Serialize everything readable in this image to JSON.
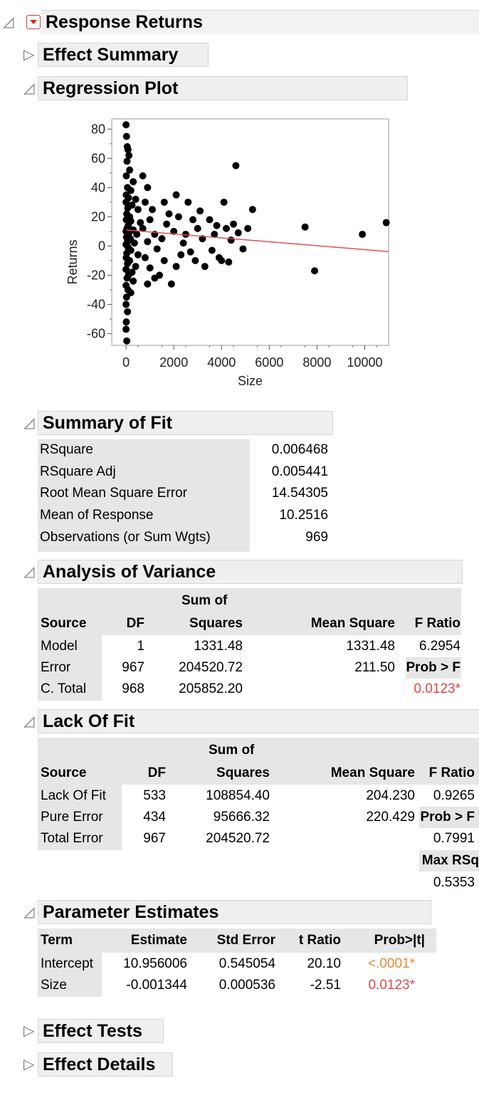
{
  "report": {
    "title": "Response Returns",
    "effect_summary": "Effect Summary",
    "regression_plot": "Regression Plot",
    "summary_of_fit": "Summary of Fit",
    "analysis_of_variance": "Analysis of Variance",
    "lack_of_fit": "Lack Of Fit",
    "parameter_estimates": "Parameter Estimates",
    "effect_tests": "Effect Tests",
    "effect_details": "Effect Details"
  },
  "chart_data": {
    "type": "scatter",
    "xlabel": "Size",
    "ylabel": "Returns",
    "xlim": [
      -600,
      11000
    ],
    "ylim": [
      -68,
      87
    ],
    "xticks": [
      "0",
      "2000",
      "4000",
      "6000",
      "8000",
      "10000"
    ],
    "yticks": [
      "80",
      "60",
      "40",
      "20",
      "0",
      "-20",
      "-40",
      "-60"
    ],
    "fit_line": {
      "intercept": 10.956006,
      "slope": -0.001344,
      "color": "#e05050"
    },
    "point_color": "#000000",
    "points": [
      [
        0,
        83
      ],
      [
        20,
        75
      ],
      [
        50,
        68
      ],
      [
        80,
        66
      ],
      [
        120,
        62
      ],
      [
        40,
        58
      ],
      [
        150,
        52
      ],
      [
        10,
        48
      ],
      [
        300,
        44
      ],
      [
        60,
        40
      ],
      [
        200,
        38
      ],
      [
        10,
        35
      ],
      [
        100,
        33
      ],
      [
        400,
        32
      ],
      [
        0,
        30
      ],
      [
        250,
        28
      ],
      [
        70,
        26
      ],
      [
        500,
        25
      ],
      [
        30,
        22
      ],
      [
        150,
        20
      ],
      [
        10,
        18
      ],
      [
        200,
        17
      ],
      [
        600,
        16
      ],
      [
        90,
        14
      ],
      [
        40,
        12
      ],
      [
        300,
        11
      ],
      [
        0,
        10
      ],
      [
        120,
        9
      ],
      [
        450,
        8
      ],
      [
        20,
        6
      ],
      [
        180,
        5
      ],
      [
        60,
        3
      ],
      [
        350,
        2
      ],
      [
        0,
        1
      ],
      [
        90,
        -1
      ],
      [
        200,
        -3
      ],
      [
        30,
        -5
      ],
      [
        500,
        -6
      ],
      [
        10,
        -8
      ],
      [
        150,
        -10
      ],
      [
        60,
        -12
      ],
      [
        400,
        -14
      ],
      [
        0,
        -16
      ],
      [
        250,
        -18
      ],
      [
        100,
        -20
      ],
      [
        40,
        -22
      ],
      [
        300,
        -24
      ],
      [
        0,
        -27
      ],
      [
        80,
        -30
      ],
      [
        200,
        -32
      ],
      [
        20,
        -35
      ],
      [
        0,
        -40
      ],
      [
        60,
        -45
      ],
      [
        10,
        -52
      ],
      [
        0,
        -57
      ],
      [
        30,
        -65
      ],
      [
        700,
        48
      ],
      [
        900,
        40
      ],
      [
        800,
        30
      ],
      [
        1100,
        25
      ],
      [
        1000,
        18
      ],
      [
        700,
        12
      ],
      [
        1200,
        8
      ],
      [
        900,
        3
      ],
      [
        1300,
        -2
      ],
      [
        800,
        -8
      ],
      [
        1000,
        -15
      ],
      [
        1200,
        -22
      ],
      [
        900,
        -26
      ],
      [
        1400,
        -20
      ],
      [
        1600,
        -10
      ],
      [
        1500,
        5
      ],
      [
        1700,
        15
      ],
      [
        1800,
        22
      ],
      [
        1600,
        30
      ],
      [
        1900,
        -26
      ],
      [
        2100,
        35
      ],
      [
        2200,
        20
      ],
      [
        2000,
        10
      ],
      [
        2400,
        2
      ],
      [
        2300,
        -6
      ],
      [
        2100,
        -14
      ],
      [
        2600,
        30
      ],
      [
        2800,
        18
      ],
      [
        2500,
        8
      ],
      [
        2700,
        -4
      ],
      [
        2900,
        -10
      ],
      [
        3100,
        24
      ],
      [
        3000,
        12
      ],
      [
        3300,
        -14
      ],
      [
        3200,
        5
      ],
      [
        3500,
        18
      ],
      [
        3700,
        8
      ],
      [
        3600,
        -3
      ],
      [
        3900,
        -8
      ],
      [
        3800,
        14
      ],
      [
        4100,
        30
      ],
      [
        4000,
        -10
      ],
      [
        4200,
        12
      ],
      [
        4400,
        4
      ],
      [
        4500,
        15
      ],
      [
        4700,
        9
      ],
      [
        4600,
        55
      ],
      [
        4900,
        -2
      ],
      [
        5100,
        12
      ],
      [
        5300,
        25
      ],
      [
        7500,
        13
      ],
      [
        7900,
        -17
      ],
      [
        9900,
        8
      ],
      [
        10900,
        16
      ],
      [
        4300,
        -11
      ]
    ]
  },
  "summary_of_fit": {
    "rows": [
      {
        "label": "RSquare",
        "value": "0.006468"
      },
      {
        "label": "RSquare Adj",
        "value": "0.005441"
      },
      {
        "label": "Root Mean Square Error",
        "value": "14.54305"
      },
      {
        "label": "Mean of Response",
        "value": "10.2516"
      },
      {
        "label": "Observations (or Sum Wgts)",
        "value": "969"
      }
    ]
  },
  "anova": {
    "headers": {
      "source": "Source",
      "df": "DF",
      "ss_top": "Sum of",
      "ss": "Squares",
      "ms": "Mean Square",
      "f": "F Ratio"
    },
    "rows": [
      {
        "source": "Model",
        "df": "1",
        "ss": "1331.48",
        "ms": "1331.48",
        "extra": "6.2954"
      },
      {
        "source": "Error",
        "df": "967",
        "ss": "204520.72",
        "ms": "211.50",
        "extra": "Prob > F"
      },
      {
        "source": "C. Total",
        "df": "968",
        "ss": "205852.20",
        "ms": "",
        "extra": "0.0123*"
      }
    ]
  },
  "lack_of_fit": {
    "headers": {
      "source": "Source",
      "df": "DF",
      "ss_top": "Sum of",
      "ss": "Squares",
      "ms": "Mean Square",
      "f": "F Ratio"
    },
    "rows": [
      {
        "source": "Lack Of Fit",
        "df": "533",
        "ss": "108854.40",
        "ms": "204.230",
        "extra": "0.9265"
      },
      {
        "source": "Pure Error",
        "df": "434",
        "ss": "95666.32",
        "ms": "220.429",
        "extra": "Prob > F"
      },
      {
        "source": "Total Error",
        "df": "967",
        "ss": "204520.72",
        "ms": "",
        "extra": "0.7991"
      }
    ],
    "max_rsq_label": "Max RSq",
    "max_rsq_value": "0.5353"
  },
  "parameter_estimates": {
    "headers": {
      "term": "Term",
      "estimate": "Estimate",
      "se": "Std Error",
      "t": "t Ratio",
      "p": "Prob>|t|"
    },
    "rows": [
      {
        "term": "Intercept",
        "estimate": "10.956006",
        "se": "0.545054",
        "t": "20.10",
        "p": "<.0001*"
      },
      {
        "term": "Size",
        "estimate": "-0.001344",
        "se": "0.000536",
        "t": "-2.51",
        "p": "0.0123*"
      }
    ]
  }
}
